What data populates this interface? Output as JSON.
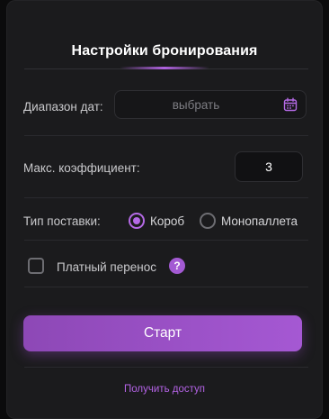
{
  "title": "Настройки бронирования",
  "date_range": {
    "label": "Диапазон дат:",
    "placeholder": "выбрать",
    "icon": "calendar-icon"
  },
  "max_coefficient": {
    "label": "Макс. коэффициент:",
    "value": "3"
  },
  "supply_type": {
    "label": "Тип поставки:",
    "options": [
      {
        "label": "Короб",
        "selected": true
      },
      {
        "label": "Монопаллета",
        "selected": false
      }
    ]
  },
  "paid_transfer": {
    "label": "Платный перенос",
    "checked": false,
    "help_icon": "?"
  },
  "start_button": {
    "label": "Старт"
  },
  "access_link": {
    "label": "Получить доступ"
  },
  "colors": {
    "accent": "#b063e0",
    "background": "#1b1b1d"
  }
}
